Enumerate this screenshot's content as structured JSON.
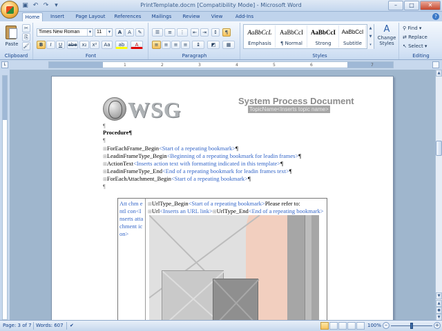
{
  "window": {
    "title": "PrintTemplate.docm [Compatibility Mode] - Microsoft Word"
  },
  "qat": {
    "save_icon": "save-icon",
    "undo_icon": "undo-icon",
    "redo_icon": "redo-icon"
  },
  "tabs": [
    {
      "label": "Home",
      "active": true
    },
    {
      "label": "Insert"
    },
    {
      "label": "Page Layout"
    },
    {
      "label": "References"
    },
    {
      "label": "Mailings"
    },
    {
      "label": "Review"
    },
    {
      "label": "View"
    },
    {
      "label": "Add-Ins"
    }
  ],
  "ribbon": {
    "clipboard": {
      "label": "Clipboard",
      "paste": "Paste"
    },
    "font": {
      "label": "Font",
      "font_name": "Times New Roman",
      "font_size": "11",
      "grow": "A",
      "shrink": "A",
      "bold": "B",
      "italic": "I",
      "underline": "U",
      "strike": "abe",
      "subscript": "x₂",
      "superscript": "x²",
      "case": "Aa",
      "highlight": "ab",
      "color": "A"
    },
    "paragraph": {
      "label": "Paragraph",
      "pilcrow": "¶"
    },
    "styles": {
      "label": "Styles",
      "items": [
        {
          "sample": "AaBbCcL",
          "name": "Emphasis"
        },
        {
          "sample": "AaBbCcI",
          "name": "¶ Normal"
        },
        {
          "sample": "AaBbCcI",
          "name": "Strong"
        },
        {
          "sample": "AaBbCcI",
          "name": "Subtitle"
        }
      ],
      "change_styles": "Change Styles"
    },
    "editing": {
      "label": "Editing",
      "find": "Find",
      "replace": "Replace",
      "select": "Select"
    }
  },
  "document": {
    "logo_text": "WSG",
    "title": "System Process Document",
    "topic_field": "TopicName<Inserts topic name>",
    "procedure": "Procedure¶",
    "lines": [
      {
        "bm": "ForEachFrame_Begin",
        "help": "<Start of a repeating bookmark>",
        "end": "¶"
      },
      {
        "bm": "LeadinFrameType_Begin",
        "help": "<Beginning of a repeating bookmark for leadin frames>",
        "end": "¶"
      },
      {
        "bm": "ActionText",
        "help": "<Inserts action text with formatting indicated in this template>",
        "end": "¶"
      },
      {
        "bm": "LeadinFrameType_End",
        "help": "<End of a repeating bookmark for leadin frames text>",
        "end": "¶"
      },
      {
        "bm": "ForEachAttachment_Begin",
        "help": "<Start of a repeating bookmark>",
        "end": "¶"
      }
    ],
    "pilcrow": "¶",
    "cell_left": "Att chm entI con<Inserts attachment icon>",
    "cell_right": {
      "line1_bm": "UrlType_Begin",
      "line1_help": "<Start of a repeating bookmark>",
      "line1_text": "Please refer to:",
      "line2_bm": "Url",
      "line2_help": "<Inserts an URL link>",
      "line2_bm2": "UrlType_End",
      "line2_help2": "<End of a repeating bookmark>"
    }
  },
  "status": {
    "page": "Page: 3 of 7",
    "words": "Words: 607",
    "zoom": "100%"
  }
}
